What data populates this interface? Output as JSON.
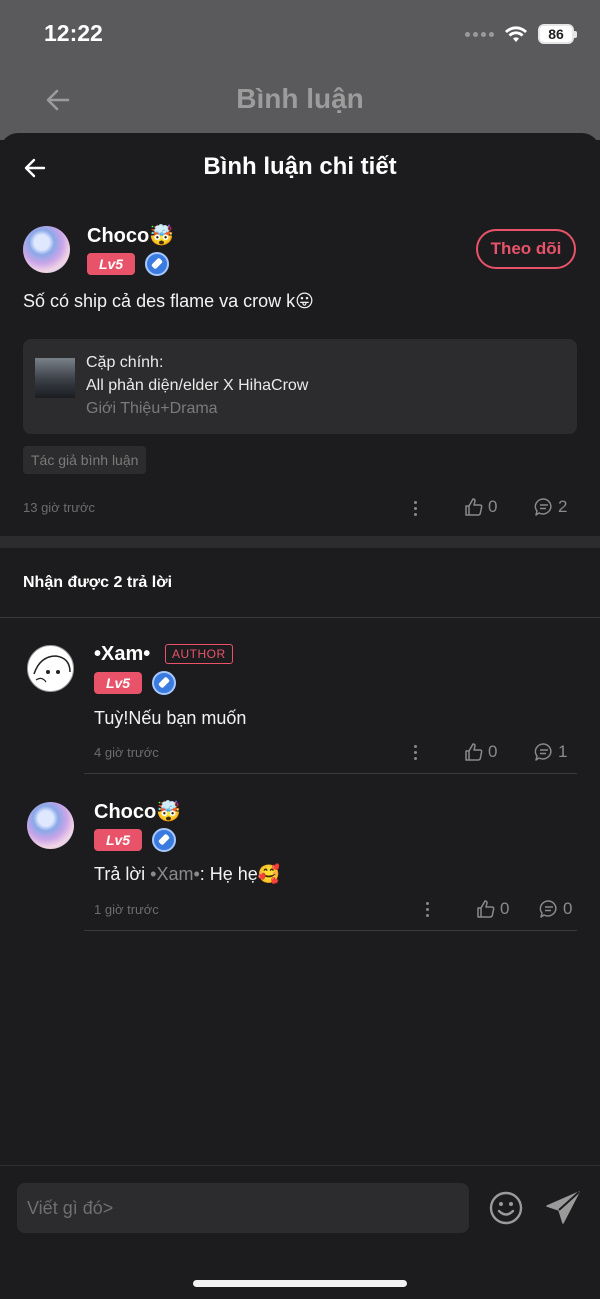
{
  "status_bar": {
    "time": "12:22",
    "battery": "86"
  },
  "background_page": {
    "title": "Bình luận"
  },
  "sheet": {
    "title": "Bình luận chi tiết"
  },
  "main_comment": {
    "user": {
      "name": "Choco",
      "name_emoji": "🤯",
      "level": "Lv5"
    },
    "follow_label": "Theo dõi",
    "text": "Số có ship cả des flame va crow k",
    "text_emoji": "😛",
    "novel": {
      "pair_label": "Cặp chính:",
      "pair_value": "All phản diện/elder X HihaCrow",
      "genres": "Giới Thiệu+Drama"
    },
    "tag": "Tác giả bình luận",
    "time": "13 giờ trước",
    "likes": "0",
    "replies": "2"
  },
  "replies_header": "Nhận được 2 trả lời",
  "replies": [
    {
      "user": {
        "name": "•Xam•",
        "level": "Lv5",
        "badge": "AUTHOR"
      },
      "text": "Tuỳ!Nếu bạn muốn",
      "time": "4 giờ trước",
      "likes": "0",
      "replies": "1"
    },
    {
      "user": {
        "name": "Choco",
        "name_emoji": "🤯",
        "level": "Lv5"
      },
      "reply_prefix": "Trả lời ",
      "mention": "•Xam•",
      "text": ": Hẹ hẹ",
      "text_emoji": "🥰",
      "time": "1 giờ trước",
      "likes": "0",
      "replies": "0"
    }
  ],
  "composer": {
    "placeholder": "Viết gì đó>"
  },
  "colors": {
    "accent": "#e8536a",
    "background": "#1c1c1e",
    "card": "#2c2c2e"
  }
}
